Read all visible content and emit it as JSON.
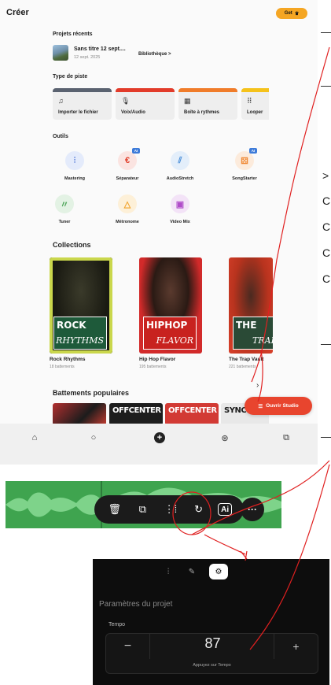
{
  "app": {
    "title": "Créer",
    "get_button": "Get",
    "get_icon": "crown-icon"
  },
  "recent": {
    "title": "Projets récents",
    "project_name": "Sans titre 12 sept....",
    "project_date": "12 sept. 2025",
    "library_link": "Bibliothèque >"
  },
  "track_types": {
    "title": "Type de piste",
    "items": [
      {
        "label": "Importer le fichier",
        "icon": "import-music-icon",
        "color": "#5a6270"
      },
      {
        "label": "Voix/Audio",
        "icon": "microphone-icon",
        "color": "#e23b2a"
      },
      {
        "label": "Boîte à rythmes",
        "icon": "drum-machine-icon",
        "color": "#f07c2a"
      },
      {
        "label": "Looper",
        "icon": "looper-grid-icon",
        "color": "#f5c21b"
      }
    ]
  },
  "tools": {
    "title": "Outils",
    "items": [
      {
        "label": "Mastering",
        "icon": "mastering-sliders-icon",
        "color": "#5b7fd9",
        "ai": ""
      },
      {
        "label": "Séparateur",
        "icon": "splitter-icon",
        "color": "#e0402c",
        "ai": "AI"
      },
      {
        "label": "AudioStretch",
        "icon": "stretch-icon",
        "color": "#4a8ed8",
        "ai": ""
      },
      {
        "label": "SongStarter",
        "icon": "dice-icon",
        "color": "#f08a36",
        "ai": "AI"
      },
      {
        "label": "Tuner",
        "icon": "tuner-icon",
        "color": "#4fa65a",
        "ai": ""
      },
      {
        "label": "Métronome",
        "icon": "metronome-icon",
        "color": "#f2a32c",
        "ai": ""
      },
      {
        "label": "Video Mix",
        "icon": "video-icon",
        "color": "#b04cc9",
        "ai": ""
      }
    ]
  },
  "collections": {
    "title": "Collections",
    "items": [
      {
        "name": "Rock Rhythms",
        "count": "18 battements",
        "word1": "ROCK",
        "word2": "RHYTHMS"
      },
      {
        "name": "Hip Hop Flavor",
        "count": "195 battements",
        "word1": "HIPHOP",
        "word2": "FLAVOR"
      },
      {
        "name": "The Trap Vault",
        "count": "221 battements",
        "word1": "THE",
        "word2": "TRAP"
      }
    ]
  },
  "popular_beats": {
    "title": "Battements populaires",
    "items": [
      "",
      "OFFCENTER",
      "OFFCENTER",
      "SYNC"
    ]
  },
  "fab": {
    "label": "Ouvrir Studio",
    "icon": "studio-icon"
  },
  "bottom_nav": [
    {
      "icon": "home-icon"
    },
    {
      "icon": "search-icon"
    },
    {
      "icon": "create-plus-icon"
    },
    {
      "icon": "community-icon"
    },
    {
      "icon": "library-icon"
    }
  ],
  "side_text": [
    "—",
    "—",
    ">",
    "C",
    "C",
    "C",
    "C",
    "—",
    "—"
  ],
  "waveform_toolbar": [
    {
      "icon": "delete-icon",
      "symbol": "🗑"
    },
    {
      "icon": "duplicate-icon",
      "symbol": "⧉"
    },
    {
      "icon": "split-icon",
      "symbol": "⋮⁞"
    },
    {
      "icon": "loop-icon",
      "symbol": "↻"
    },
    {
      "icon": "ai-tools-icon",
      "symbol": "Ai"
    }
  ],
  "more_button": "···",
  "settings": {
    "tabs": [
      "waveform-tab-icon",
      "pen-tab-icon",
      "settings-tab-icon"
    ],
    "title": "Paramètres du projet",
    "tempo_label": "Tempo",
    "tempo_value": "87",
    "tempo_minus": "−",
    "tempo_plus": "+",
    "tempo_hint": "Appuyez sur Tempo"
  },
  "colors": {
    "accent": "#e8452e",
    "annotation": "#e02020",
    "waveform": "#3fa44f"
  }
}
